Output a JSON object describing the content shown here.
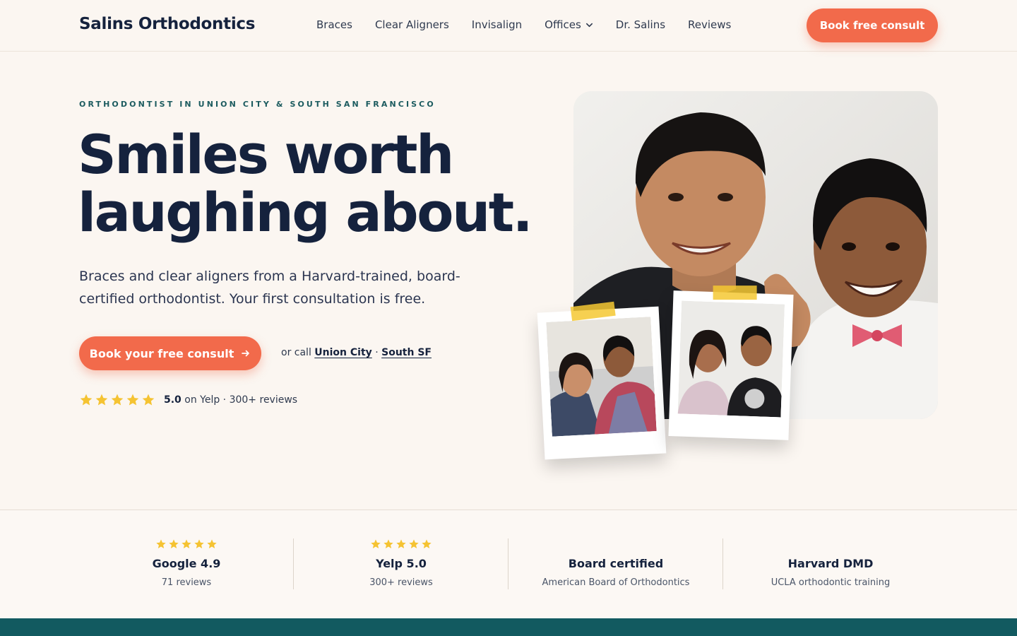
{
  "nav": {
    "logo": "Salins Orthodontics",
    "links": [
      "Braces",
      "Clear Aligners",
      "Invisalign",
      "Offices",
      "Dr. Salins",
      "Reviews"
    ],
    "cta": "Book free consult"
  },
  "hero": {
    "eyebrow": "ORTHODONTIST IN UNION CITY & SOUTH SAN FRANCISCO",
    "headline_line1": "Smiles worth",
    "headline_line2": "laughing about.",
    "subtext": "Braces and clear aligners from a Harvard-trained, board-certified orthodontist. Your first consultation is free.",
    "cta": "Book your free consult",
    "call_prefix": "or call",
    "call_union_city": "Union City",
    "call_separator": "·",
    "call_south_sf": "South SF",
    "rating_value": "5.0",
    "rating_rest": "on Yelp · 300+ reviews",
    "rating_stars": 5
  },
  "stats": [
    {
      "stars": 5,
      "title": "Google 4.9",
      "sub": "71 reviews"
    },
    {
      "stars": 5,
      "title": "Yelp 5.0",
      "sub": "300+ reviews"
    },
    {
      "stars": 0,
      "title": "Board certified",
      "sub": "American Board of Orthodontics"
    },
    {
      "stars": 0,
      "title": "Harvard DMD",
      "sub": "UCLA orthodontic training"
    }
  ],
  "colors": {
    "accent": "#f26a4b",
    "navy": "#15223d",
    "teal": "#125a60",
    "star": "#f5c332",
    "background": "#fbf6f1"
  },
  "icons": [
    "chevron-down-icon",
    "arrow-right-icon",
    "star-icon"
  ]
}
